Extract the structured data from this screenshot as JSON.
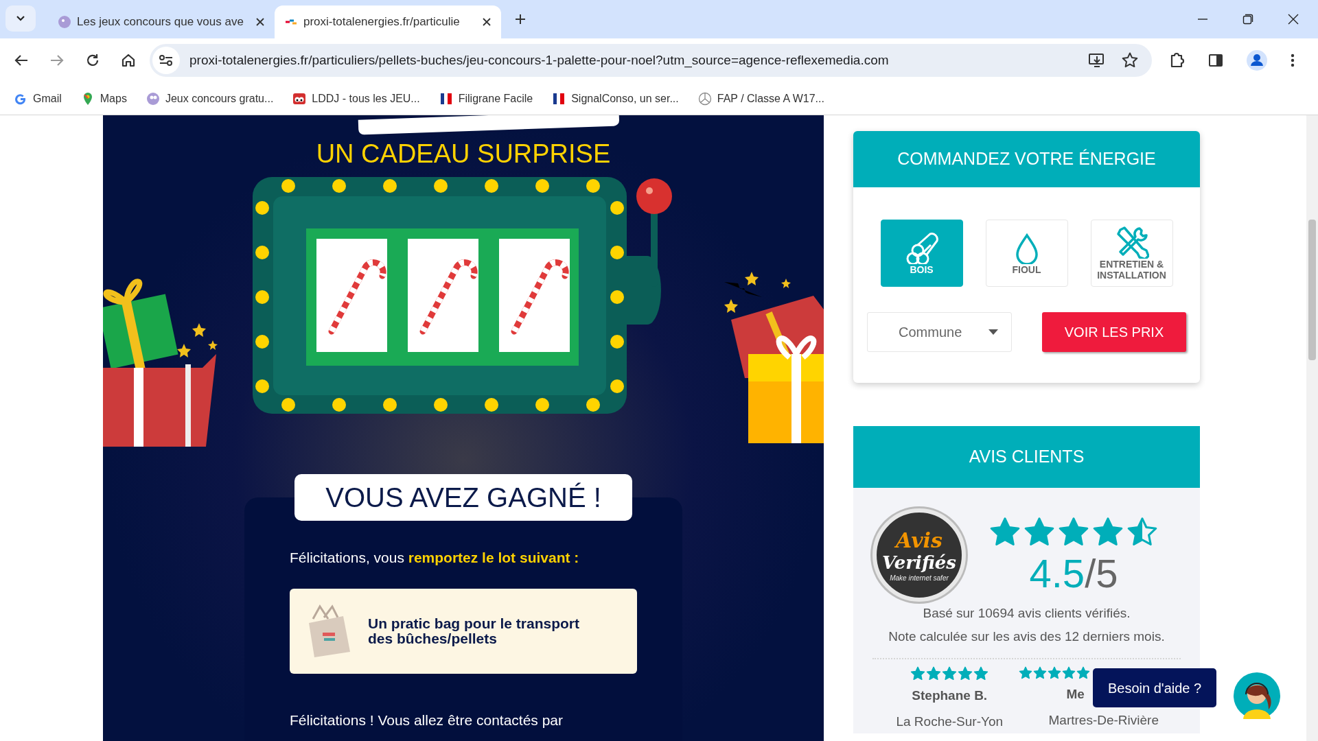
{
  "browser": {
    "tabs": [
      {
        "title": "Les jeux concours que vous ave",
        "selected": false
      },
      {
        "title": "proxi-totalenergies.fr/particulie",
        "selected": true
      }
    ],
    "url": "proxi-totalenergies.fr/particuliers/pellets-buches/jeu-concours-1-palette-pour-noel?utm_source=agence-reflexemedia.com",
    "bookmarks": [
      {
        "label": "Gmail",
        "kind": "g"
      },
      {
        "label": "Maps",
        "kind": "pin"
      },
      {
        "label": "Jeux concours gratu...",
        "kind": "mascot"
      },
      {
        "label": "LDDJ - tous les JEU...",
        "kind": "eyes"
      },
      {
        "label": "Filigrane Facile",
        "kind": "flag"
      },
      {
        "label": "SignalConso, un ser...",
        "kind": "flag"
      },
      {
        "label": "FAP / Classe A W17...",
        "kind": "star"
      }
    ]
  },
  "game": {
    "subtitle": "UN CADEAU SURPRISE",
    "result_title": "VOUS AVEZ GAGNÉ !",
    "message": "Félicitations, vous **remportez le lot suivant :**",
    "prize": "Un pratic bag pour le transport des bûches/pellets",
    "footer_text": "Félicitations ! Vous allez être contactés par"
  },
  "order_panel": {
    "title": "COMMANDEZ VOTRE ÉNERGIE",
    "energies": [
      {
        "label": "BOIS",
        "kind": "logs",
        "selected": true
      },
      {
        "label": "FIOUL",
        "kind": "drop",
        "selected": false
      },
      {
        "label": "ENTRETIEN & INSTALLATION",
        "kind": "tools",
        "selected": false
      }
    ],
    "commune": {
      "placeholder": "Commune"
    },
    "button": "VOIR LES PRIX"
  },
  "reviews": {
    "title": "AVIS CLIENTS",
    "badge": {
      "line1": "Avis",
      "line2": "Verifiés",
      "tagline": "Make internet safer"
    },
    "stars": 4.5,
    "score": "4.5",
    "out_of": "/5",
    "summary": [
      "Basé sur 10694 avis clients vérifiés.",
      "Note calculée sur les avis des 12 derniers mois."
    ],
    "items": [
      {
        "stars": 5,
        "name": "Stephane B.",
        "place": "La Roche-Sur-Yon"
      },
      {
        "stars": 5,
        "name": "Me",
        "place": "Martres-De-Rivière"
      }
    ]
  },
  "chat": {
    "label": "Besoin d'aide ?"
  }
}
